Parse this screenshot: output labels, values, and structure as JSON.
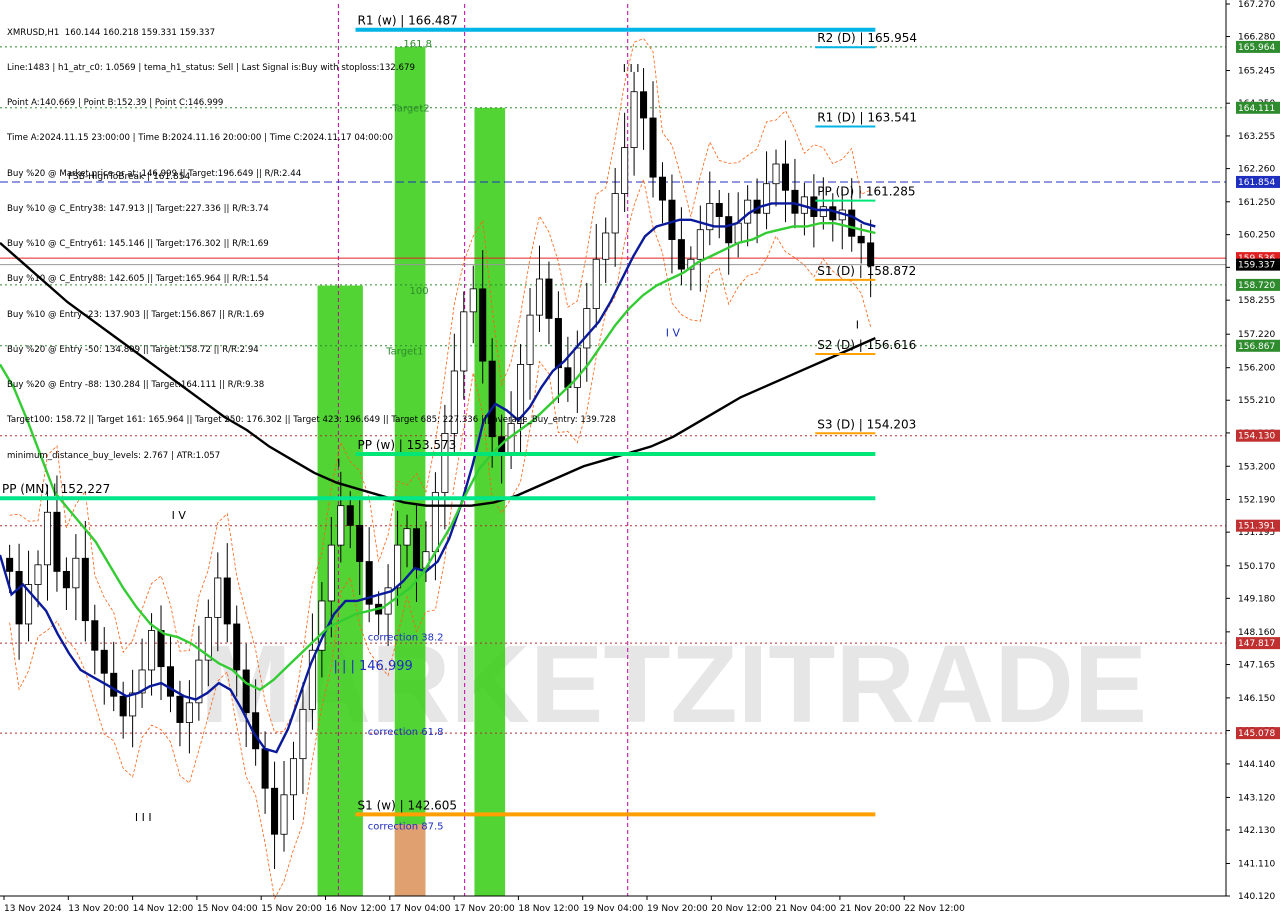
{
  "chart_data": {
    "type": "candlestick",
    "title": "XMRUSD,H1",
    "header_line": "XMRUSD,H1  160.144 160.218 159.331 159.337",
    "info_lines": [
      "Line:1483 | h1_atr_c0: 1.0569 | tema_h1_status: Sell | Last Signal is:Buy with stoploss:132.679",
      "Point A:140.669 | Point B:152.39 | Point C:146.999",
      "Time A:2024.11.15 23:00:00 | Time B:2024.11.16 20:00:00 | Time C:2024.11.17 04:00:00",
      "Buy %20 @ Market price or at: 146.999 || Target:196.649 || R/R:2.44",
      "Buy %10 @ C_Entry38: 147.913 || Target:227.336 || R/R:3.74",
      "Buy %10 @ C_Entry61: 145.146 || Target:176.302 || R/R:1.69",
      "Buy %10 @ C_Entry88: 142.605 || Target:165.964 || R/R:1.54",
      "Buy %10 @ Entry -23: 137.903 || Target:156.867 || R/R:1.69",
      "Buy %20 @ Entry -50: 134.809 || Target:158.72 || R/R:2.94",
      "Buy %20 @ Entry -88: 130.284 || Target:164.111 || R/R:9.38",
      "Target100: 158.72 || Target 161: 165.964 || Target 250: 176.302 || Target 423: 196.649 || Target 685: 227.336 ||| average_Buy_entry: 139.728",
      "minimum_distance_buy_levels: 2.767 | ATR:1.057"
    ],
    "ylim": [
      140.12,
      167.27
    ],
    "y_ticks": [
      "167.270",
      "166.280",
      "165.245",
      "164.250",
      "163.255",
      "162.260",
      "161.250",
      "160.250",
      "159.255",
      "158.255",
      "157.220",
      "156.200",
      "155.210",
      "154.215",
      "153.200",
      "152.190",
      "151.195",
      "150.170",
      "149.180",
      "148.160",
      "147.165",
      "146.150",
      "145.155",
      "144.140",
      "143.120",
      "142.130",
      "141.110",
      "140.120"
    ],
    "x_ticks": [
      "13 Nov 2024",
      "13 Nov 20:00",
      "14 Nov 12:00",
      "15 Nov 04:00",
      "15 Nov 20:00",
      "16 Nov 12:00",
      "17 Nov 04:00",
      "17 Nov 20:00",
      "18 Nov 12:00",
      "19 Nov 04:00",
      "19 Nov 20:00",
      "20 Nov 12:00",
      "21 Nov 04:00",
      "21 Nov 20:00",
      "22 Nov 12:00"
    ],
    "price_badges": [
      {
        "label": "165.964",
        "value": 165.964,
        "color": "#2e8b2e"
      },
      {
        "label": "164.111",
        "value": 164.111,
        "color": "#2e8b2e"
      },
      {
        "label": "161.854",
        "value": 161.854,
        "color": "#1e2fbf"
      },
      {
        "label": "159.536",
        "value": 159.536,
        "color": "#e02020"
      },
      {
        "label": "159.337",
        "value": 159.337,
        "color": "#000000"
      },
      {
        "label": "158.720",
        "value": 158.72,
        "color": "#2e8b2e"
      },
      {
        "label": "156.867",
        "value": 156.867,
        "color": "#2e8b2e"
      },
      {
        "label": "154.130",
        "value": 154.13,
        "color": "#c03030"
      },
      {
        "label": "151.391",
        "value": 151.391,
        "color": "#c03030"
      },
      {
        "label": "147.817",
        "value": 147.817,
        "color": "#c03030"
      },
      {
        "label": "145.078",
        "value": 145.078,
        "color": "#c03030"
      }
    ],
    "dotted_levels": [
      {
        "value": 165.964,
        "color": "#2e8b2e"
      },
      {
        "value": 164.111,
        "color": "#2e8b2e"
      },
      {
        "value": 158.72,
        "color": "#2e8b2e"
      },
      {
        "value": 156.867,
        "color": "#2e8b2e"
      },
      {
        "value": 154.13,
        "color": "#b03030"
      },
      {
        "value": 151.391,
        "color": "#b03030"
      },
      {
        "value": 147.817,
        "color": "#b03030"
      },
      {
        "value": 145.078,
        "color": "#b03030"
      }
    ],
    "fsb_line": {
      "label": "FSB-HighToBreak | 161.854",
      "value": 161.854,
      "color": "#1e2fbf"
    },
    "pivots": [
      {
        "label": "R1 (w) | 166.487",
        "value": 166.487,
        "color": "#00b4e6",
        "x_start": 0.29,
        "x_end": 0.714,
        "thick": true
      },
      {
        "label": "PP (w) | 153.573",
        "value": 153.573,
        "color": "#00e676",
        "x_start": 0.29,
        "x_end": 0.714,
        "thick": true
      },
      {
        "label": "S1 (w) | 142.605",
        "value": 142.605,
        "color": "#ffa000",
        "x_start": 0.29,
        "x_end": 0.714,
        "thick": true
      },
      {
        "label": "PP (MN) | 152.227",
        "value": 152.227,
        "color": "#00e68a",
        "x_start": 0.0,
        "x_end": 0.714,
        "thick": true
      },
      {
        "label": "R2 (D) | 165.954",
        "value": 165.954,
        "color": "#00b4e6",
        "x_start": 0.665,
        "x_end": 0.714,
        "thick": false
      },
      {
        "label": "R1 (D) | 163.541",
        "value": 163.541,
        "color": "#00b4e6",
        "x_start": 0.665,
        "x_end": 0.714,
        "thick": false
      },
      {
        "label": "PP (D) | 161.285",
        "value": 161.285,
        "color": "#00e676",
        "x_start": 0.665,
        "x_end": 0.714,
        "thick": false
      },
      {
        "label": "S1 (D) | 158.872",
        "value": 158.872,
        "color": "#ffa000",
        "x_start": 0.665,
        "x_end": 0.714,
        "thick": false
      },
      {
        "label": "S2 (D) | 156.616",
        "value": 156.616,
        "color": "#ffa000",
        "x_start": 0.665,
        "x_end": 0.714,
        "thick": false
      },
      {
        "label": "S3 (D) | 154.203",
        "value": 154.203,
        "color": "#ffa000",
        "x_start": 0.665,
        "x_end": 0.714,
        "thick": false
      }
    ],
    "zones": [
      {
        "x_start": 0.259,
        "x_end": 0.296,
        "top": 158.7,
        "color": "#33cc11",
        "label": ""
      },
      {
        "x_start": 0.322,
        "x_end": 0.347,
        "top": 165.96,
        "color": "#33cc11",
        "label": "161.8"
      },
      {
        "x_start": 0.387,
        "x_end": 0.412,
        "top": 164.11,
        "color": "#33cc11",
        "label": ""
      }
    ],
    "zone_labels": [
      {
        "text": "161.8",
        "value": 165.96,
        "x": 0.329,
        "color": "#2e8b2e"
      },
      {
        "text": "Target2",
        "value": 164.0,
        "x": 0.32,
        "color": "#2e8b2e"
      },
      {
        "text": "100",
        "value": 158.45,
        "x": 0.334,
        "color": "#2e8b2e"
      },
      {
        "text": "Target1",
        "value": 156.6,
        "x": 0.315,
        "color": "#2e8b2e"
      },
      {
        "text": "correction 38.2",
        "value": 147.9,
        "x": 0.3,
        "color": "#1e2fbf"
      },
      {
        "text": "correction 61.8",
        "value": 145.02,
        "x": 0.3,
        "color": "#1e2fbf"
      },
      {
        "text": "correction 87.5",
        "value": 142.15,
        "x": 0.3,
        "color": "#1e2fbf"
      },
      {
        "text": "| | | 146.999",
        "value": 146.999,
        "x": 0.272,
        "color": "#1e2fbf"
      }
    ],
    "wave_labels": [
      {
        "text": "I I I",
        "value": 142.4,
        "x": 0.11
      },
      {
        "text": "I V",
        "value": 151.6,
        "x": 0.14
      },
      {
        "text": "I",
        "value": 153.2,
        "x": 0.275
      },
      {
        "text": "I I I",
        "value": 165.2,
        "x": 0.508
      },
      {
        "text": "I V",
        "value": 157.15,
        "x": 0.543
      },
      {
        "text": "I",
        "value": 157.4,
        "x": 0.698
      }
    ],
    "vlines_x": [
      0.276,
      0.379,
      0.512
    ],
    "watermark": "MARKETZITRADE",
    "series": [
      {
        "name": "price",
        "close": [
          150.0,
          148.4,
          149.6,
          150.2,
          151.8,
          150.0,
          149.5,
          150.4,
          148.5,
          147.6,
          146.9,
          146.2,
          145.6,
          146.3,
          147.0,
          148.2,
          147.1,
          146.2,
          145.4,
          146.0,
          147.3,
          148.6,
          149.8,
          148.4,
          147.0,
          145.7,
          144.6,
          143.4,
          142.0,
          143.2,
          144.3,
          145.8,
          147.6,
          149.1,
          150.8,
          152.0,
          151.4,
          150.3,
          149.0,
          148.7,
          149.5,
          150.8,
          151.3,
          150.1,
          150.6,
          152.4,
          154.2,
          156.1,
          157.9,
          158.6,
          156.4,
          154.1,
          153.6,
          154.5,
          156.3,
          157.8,
          158.9,
          157.7,
          156.2,
          155.6,
          156.8,
          158.0,
          159.5,
          160.3,
          161.5,
          162.9,
          164.6,
          163.8,
          162.0,
          161.3,
          160.1,
          159.2,
          159.5,
          160.4,
          161.2,
          160.8,
          160.0,
          160.6,
          161.3,
          160.9,
          161.8,
          162.4,
          161.6,
          160.9,
          161.4,
          160.8,
          161.1,
          160.7,
          161.0,
          160.2,
          160.0,
          159.3
        ]
      },
      {
        "name": "blue_ma",
        "values": [
          150.5,
          149.3,
          149.6,
          149.2,
          148.8,
          148.1,
          147.5,
          147.0,
          146.8,
          146.6,
          146.4,
          146.2,
          146.3,
          146.5,
          146.6,
          146.4,
          146.2,
          146.1,
          146.3,
          146.6,
          146.4,
          145.8,
          145.1,
          144.6,
          144.5,
          145.2,
          146.2,
          147.2,
          148.0,
          148.7,
          149.1,
          149.1,
          149.2,
          149.3,
          149.4,
          149.7,
          150.1,
          150.0,
          150.3,
          151.0,
          152.0,
          153.2,
          154.6,
          155.1,
          154.9,
          154.6,
          155.0,
          155.6,
          156.1,
          156.4,
          156.8,
          157.2,
          157.6,
          158.2,
          158.9,
          159.6,
          160.2,
          160.5,
          160.6,
          160.7,
          160.7,
          160.6,
          160.5,
          160.5,
          160.6,
          160.9,
          161.1,
          161.2,
          161.2,
          161.2,
          161.1,
          161.0,
          161.0,
          160.9,
          160.8,
          160.6,
          160.5
        ]
      },
      {
        "name": "green_ma",
        "values": [
          156.3,
          155.6,
          154.6,
          153.5,
          152.4,
          151.9,
          151.4,
          150.9,
          150.2,
          149.5,
          148.9,
          148.4,
          148.1,
          148.0,
          147.8,
          147.5,
          147.2,
          147.0,
          146.6,
          146.4,
          146.7,
          147.1,
          147.5,
          147.9,
          148.3,
          148.5,
          148.7,
          148.8,
          148.9,
          149.2,
          149.5,
          150.0,
          150.7,
          151.4,
          152.3,
          153.1,
          153.6,
          154.0,
          154.3,
          154.6,
          155.0,
          155.4,
          155.8,
          156.3,
          156.9,
          157.5,
          158.0,
          158.4,
          158.7,
          158.9,
          159.1,
          159.4,
          159.6,
          159.8,
          160.0,
          160.1,
          160.3,
          160.4,
          160.5,
          160.5,
          160.6,
          160.6,
          160.5,
          160.4,
          160.3
        ]
      },
      {
        "name": "black_ma",
        "values": [
          160.0,
          159.4,
          158.8,
          158.2,
          157.7,
          157.2,
          156.7,
          156.2,
          155.7,
          155.2,
          154.7,
          154.3,
          153.8,
          153.4,
          153.0,
          152.7,
          152.5,
          152.3,
          152.1,
          152.0,
          152.0,
          152.0,
          152.1,
          152.3,
          152.6,
          152.9,
          153.2,
          153.4,
          153.6,
          153.8,
          154.1,
          154.5,
          154.9,
          155.3,
          155.6,
          155.9,
          156.2,
          156.5,
          156.8,
          157.1
        ]
      }
    ]
  }
}
